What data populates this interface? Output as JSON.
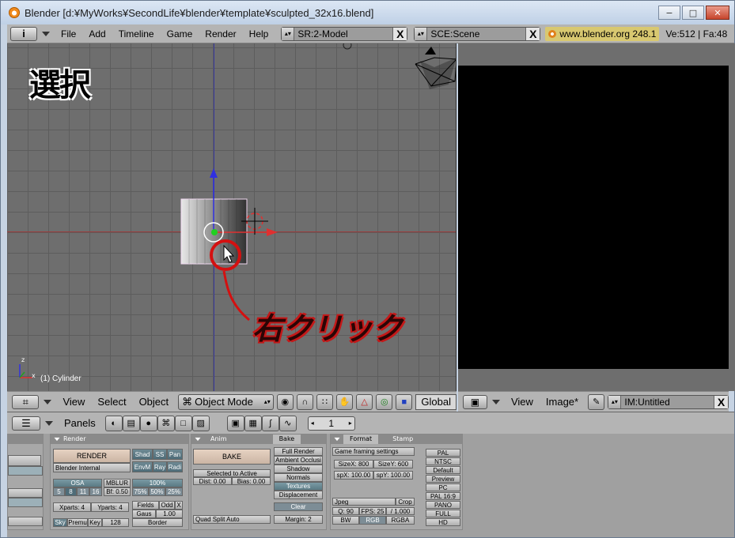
{
  "window": {
    "title": "Blender [d:¥MyWorks¥SecondLife¥blender¥template¥sculpted_32x16.blend]",
    "minimize_label": "−",
    "maximize_label": "□",
    "close_label": "✕"
  },
  "topbar": {
    "info_btn": "i",
    "menus": [
      "File",
      "Add",
      "Timeline",
      "Game",
      "Render",
      "Help"
    ],
    "screen_field": "SR:2-Model",
    "scene_field": "SCE:Scene",
    "clear_label": "X",
    "url": "www.blender.org 248.1",
    "stats": "Ve:512 | Fa:48"
  },
  "viewport": {
    "annotation_select": "選択",
    "annotation_rightclick": "右クリック",
    "object_label": "(1) Cylinder",
    "axis_z": "z",
    "axis_x": "x"
  },
  "view_header": {
    "menus": [
      "View",
      "Select",
      "Object"
    ],
    "mode": "Object Mode",
    "orientation": "Global"
  },
  "image_header": {
    "menus": [
      "View",
      "Image*"
    ],
    "image_field": "IM:Untitled",
    "clear_label": "X"
  },
  "buttons_header": {
    "panels_label": "Panels",
    "frame": "1"
  },
  "render_panel": {
    "tab": "Render",
    "render_btn": "RENDER",
    "renderer": "Blender Internal",
    "shad": "Shad",
    "ss": "SS",
    "pan": "Pan",
    "envm": "EnvM",
    "ray": "Ray",
    "radi": "Radi",
    "osa": "OSA",
    "mblur": "MBLUR",
    "pct100": "100%",
    "osa_vals": [
      "5",
      "8",
      "11",
      "16"
    ],
    "bf": "Bf: 0.50",
    "pct_vals": [
      "75%",
      "50%",
      "25%"
    ],
    "xparts": "Xparts: 4",
    "yparts": "Yparts: 4",
    "fields": "Fields",
    "odd": "Odd",
    "x_btn": "X",
    "gaus": "Gaus",
    "gaus_val": "1.00",
    "sky": "Sky",
    "premu": "Premu",
    "key": "Key",
    "key_val": "128",
    "border": "Border"
  },
  "bake_panel": {
    "tabs": [
      "Anim",
      "Bake"
    ],
    "bake_btn": "BAKE",
    "selected_to_active": "Selected to Active",
    "dist": "Dist: 0.00",
    "bias": "Bias: 0.00",
    "options": [
      "Full Render",
      "Ambient Occlusi",
      "Shadow",
      "Normals",
      "Textures",
      "Displacement"
    ],
    "clear": "Clear",
    "mode": "Quad Split Auto",
    "margin": "Margin: 2"
  },
  "format_panel": {
    "tabs": [
      "Format",
      "Stamp"
    ],
    "game_framing": "Game framing settings",
    "sizex": "SizeX: 800",
    "sizey": "SizeY: 600",
    "spx": "spX: 100.00",
    "spy": "spY: 100.00",
    "format": "Jpeg",
    "crop": "Crop",
    "q": "Q: 90",
    "fps": "FPS: 25",
    "gamma": "/ 1.000",
    "bw": "BW",
    "rgb": "RGB",
    "rgba": "RGBA",
    "presets": [
      "PAL",
      "NTSC",
      "Default",
      "Preview",
      "PC",
      "PAL 16:9",
      "PANO",
      "FULL",
      "HD"
    ]
  }
}
